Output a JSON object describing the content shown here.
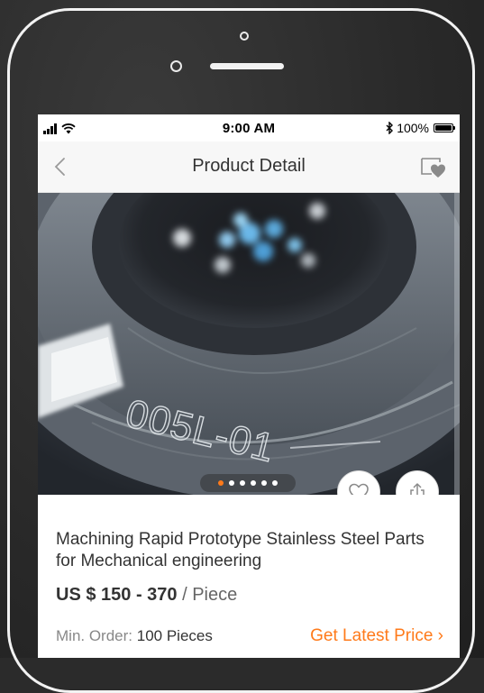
{
  "status_bar": {
    "time": "9:00 AM",
    "battery": "100%",
    "icons": [
      "signal-icon",
      "wifi-icon",
      "bluetooth-icon",
      "battery-icon"
    ]
  },
  "nav": {
    "title": "Product Detail",
    "back_icon": "chevron-left-icon",
    "favorites_icon": "heart-folder-icon"
  },
  "gallery": {
    "image_text": "005L-01",
    "total_images": 6,
    "active_index": 0,
    "colors": {
      "active_dot": "#ff7a1a",
      "dot": "#ffffff"
    }
  },
  "actions": {
    "favorite_icon": "heart-icon",
    "share_icon": "share-icon"
  },
  "product": {
    "title": "Machining Rapid Prototype Stainless Steel Parts for Mechanical engineering",
    "price": "US $ 150 - 370",
    "price_unit": " / Piece",
    "min_order_label": "Min. Order: ",
    "min_order_value": "100 Pieces",
    "cta": "Get Latest Price ›"
  },
  "colors": {
    "accent": "#ff7a1a",
    "text": "#333333",
    "muted": "#888888"
  }
}
